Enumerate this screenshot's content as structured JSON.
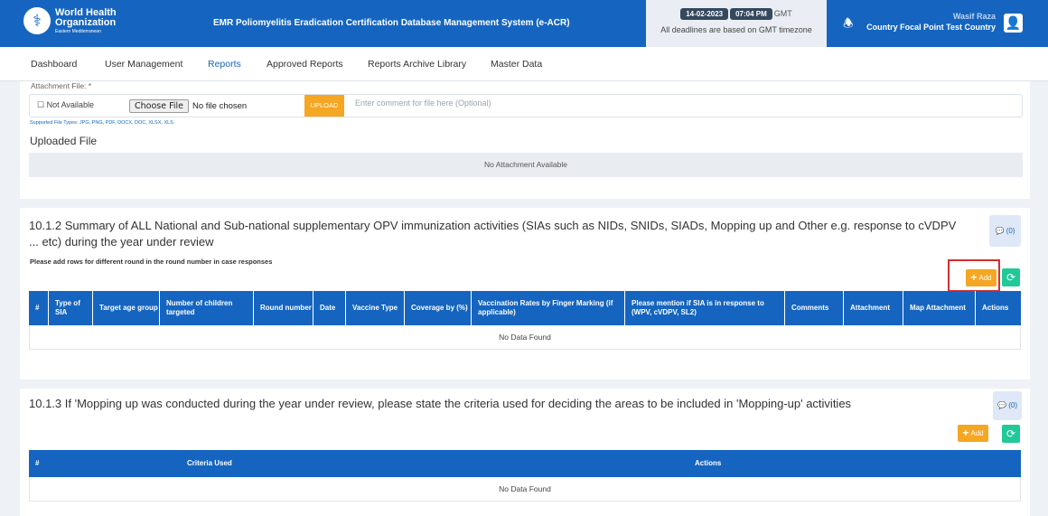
{
  "header": {
    "logo_line1": "World Health",
    "logo_line2": "Organization",
    "logo_line3": "Eastern Mediterranean",
    "app_title": "EMR Poliomyelitis Eradication Certification Database Management System (e-ACR)",
    "date": "14-02-2023",
    "time": "07:04 PM",
    "tz": "GMT",
    "deadline_note": "All deadlines are based on GMT timezone",
    "user_name": "Wasif Raza",
    "user_role": "Country Focal Point Test Country"
  },
  "nav": {
    "items": [
      "Dashboard",
      "User Management",
      "Reports",
      "Approved Reports",
      "Reports Archive Library",
      "Master Data"
    ],
    "active": "Reports"
  },
  "attachment": {
    "label": "Attachment File: *",
    "not_available": "Not Available",
    "choose_file": "Choose File",
    "no_file": "No file chosen",
    "upload": "UPLOAD",
    "comment_placeholder": "Enter comment for file here (Optional)",
    "supported": "Supported File Types: JPG, PNG, PDF, DOCX, DOC, XLSX, XLS.",
    "uploaded_title": "Uploaded File",
    "no_attachment": "No Attachment Available"
  },
  "section_1012": {
    "title": "10.1.2 Summary of ALL National and Sub-national supplementary OPV immunization activities (SIAs such as NIDs, SNIDs, SIADs, Mopping up and Other e.g. response to cVDPV ... etc) during the year under review",
    "comment_count": "(0)",
    "hint": "Please add rows for different round in the round number in case responses",
    "add_label": "Add",
    "columns": [
      "#",
      "Type of SIA",
      "Target age group",
      "Number of children targeted",
      "Round number",
      "Date",
      "Vaccine Type",
      "Coverage by (%)",
      "Vaccination Rates by Finger Marking (if applicable)",
      "Please mention if SIA is in response to (WPV, cVDPV, SL2)",
      "Comments",
      "Attachment",
      "Map Attachment",
      "Actions"
    ],
    "empty": "No Data Found"
  },
  "section_1013": {
    "title": "10.1.3 If 'Mopping up was conducted during the year under review, please state the criteria used for deciding the areas to be included in 'Mopping-up' activities",
    "comment_count": "(0)",
    "add_label": "Add",
    "columns": [
      "#",
      "Criteria Used",
      "Actions"
    ],
    "empty": "No Data Found"
  },
  "colors": {
    "primary": "#1565c0",
    "accent": "#f5a623",
    "refresh": "#20c997",
    "highlight": "#d32f2f"
  }
}
